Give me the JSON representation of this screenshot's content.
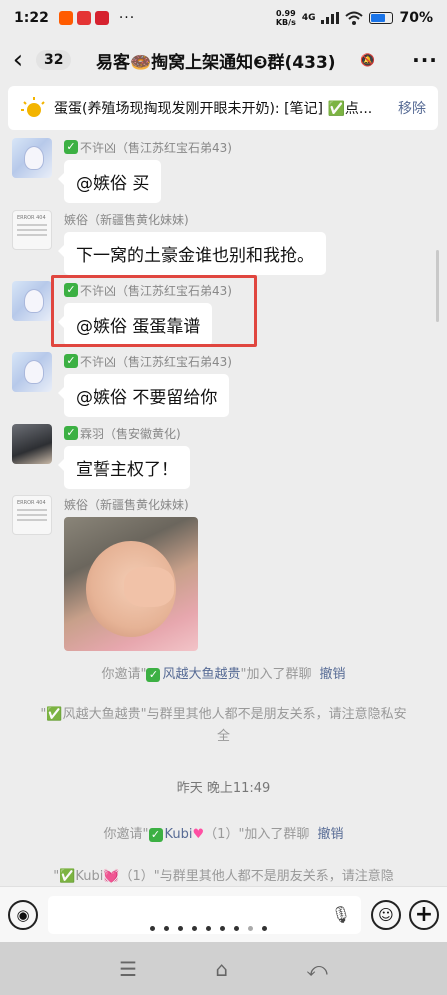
{
  "status": {
    "time": "1:22",
    "more": "···",
    "net_speed": "0.99",
    "net_unit": "KB/s",
    "net_type": "4G",
    "battery": "70%",
    "battery_level": 0.7,
    "app_icons": [
      {
        "label": "淘",
        "color": "#ff5b00"
      },
      {
        "label": "咪",
        "color": "#e43434"
      },
      {
        "label": "拼",
        "color": "#d6222f"
      }
    ]
  },
  "header": {
    "back_icon": "chevron-left-icon",
    "unread_count": "32",
    "title": "易客🍩掏窝上架通知❸群(433)",
    "mute_icon": "bell-off-icon",
    "menu_icon": "more-icon"
  },
  "pinned": {
    "text": "蛋蛋(养殖场现掏现发刚开眼未开奶): [笔记] ✅点...",
    "remove_label": "移除"
  },
  "messages": [
    {
      "name": "不许凶（售江苏红宝石弟43)",
      "verified": true,
      "text": "@嫉俗  买",
      "avatar": "anime"
    },
    {
      "name": "嫉俗（新疆售黄化妹妹)",
      "verified": false,
      "text": "下一窝的土豪金谁也别和我抢。",
      "avatar": "doc"
    },
    {
      "name": "不许凶（售江苏红宝石弟43)",
      "verified": true,
      "text": "@嫉俗  蛋蛋靠谱",
      "avatar": "anime"
    },
    {
      "name": "不许凶（售江苏红宝石弟43)",
      "verified": true,
      "text": "@嫉俗  不要留给你",
      "avatar": "anime"
    },
    {
      "name": "霖羽（售安徽黄化)",
      "verified": true,
      "text": "宣誓主权了！",
      "avatar": "girl"
    },
    {
      "name": "嫉俗（新疆售黄化妹妹)",
      "verified": false,
      "text": "",
      "avatar": "doc",
      "image": "baby-photo"
    }
  ],
  "system": {
    "invite1_prefix": "你邀请\"",
    "invite1_name": "风越大鱼越贵",
    "invite1_suffix": "\"加入了群聊",
    "revoke_label": "撤销",
    "notice1": "\"✅风越大鱼越贵\"与群里其他人都不是朋友关系，请注意隐私安全",
    "timestamp": "昨天 晚上11:49",
    "invite2_prefix": "你邀请\"",
    "invite2_name": "Kubi",
    "invite2_suffix": "（1）\"加入了群聊",
    "notice2": "\"✅Kubi💓（1）\"与群里其他人都不是朋友关系，请注意隐"
  },
  "avatar_doc_text": "ERROR 404",
  "input": {
    "voice_icon": "voice-icon",
    "mic_icon": "mic-icon",
    "emoji_icon": "emoji-icon",
    "plus_icon": "plus-icon"
  },
  "navbar": [
    "menu-icon",
    "home-icon",
    "back-icon"
  ]
}
